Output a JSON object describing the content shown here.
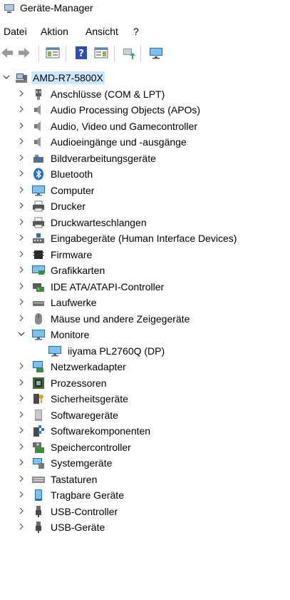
{
  "window": {
    "title": "Geräte-Manager"
  },
  "menu": {
    "items": [
      "Datei",
      "Aktion",
      "Ansicht",
      "?"
    ]
  },
  "toolbar": {
    "buttons": [
      "back-icon",
      "forward-icon",
      "show-hide-console-tree-icon",
      "help-icon",
      "properties-pane-icon",
      "update-driver-icon",
      "scan-hardware-icon"
    ]
  },
  "tree": {
    "root": "AMD-R7-5800X",
    "categories": [
      "Anschlüsse (COM & LPT)",
      "Audio Processing Objects (APOs)",
      "Audio, Video und Gamecontroller",
      "Audioeingänge und -ausgänge",
      "Bildverarbeitungsgeräte",
      "Bluetooth",
      "Computer",
      "Drucker",
      "Druckwarteschlangen",
      "Eingabegeräte (Human Interface Devices)",
      "Firmware",
      "Grafikkarten",
      "IDE ATA/ATAPI-Controller",
      "Laufwerke",
      "Mäuse und andere Zeigegeräte",
      "Monitore",
      "Netzwerkadapter",
      "Prozessoren",
      "Sicherheitsgeräte",
      "Softwaregeräte",
      "Softwarekomponenten",
      "Speichercontroller",
      "Systemgeräte",
      "Tastaturen",
      "Tragbare Geräte",
      "USB-Controller",
      "USB-Geräte"
    ],
    "monitor_child": "iiyama PL2760Q (DP)"
  },
  "colors": {
    "selection": "#cce8ff",
    "accent": "#1e88e5"
  }
}
